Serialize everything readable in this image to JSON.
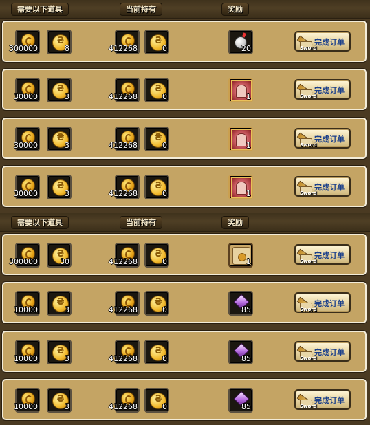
{
  "headers": {
    "required": "需要以下道具",
    "current": "当前持有",
    "reward": "奖励"
  },
  "button": {
    "label": "完成订单",
    "sublabel": "Sword"
  },
  "sections": [
    {
      "rows": [
        {
          "req_coin": "300000",
          "req_token": "8",
          "have_coin": "412268",
          "have_token": "0",
          "reward_icon": "bomb-icon",
          "reward_qty": "20"
        },
        {
          "req_coin": "30000",
          "req_token": "3",
          "have_coin": "412268",
          "have_token": "0",
          "reward_icon": "relic-icon",
          "reward_qty": "1"
        },
        {
          "req_coin": "30000",
          "req_token": "3",
          "have_coin": "412268",
          "have_token": "0",
          "reward_icon": "relic-icon",
          "reward_qty": "1"
        },
        {
          "req_coin": "30000",
          "req_token": "3",
          "have_coin": "412268",
          "have_token": "0",
          "reward_icon": "relic-icon",
          "reward_qty": "1"
        }
      ]
    },
    {
      "rows": [
        {
          "req_coin": "300000",
          "req_token": "30",
          "have_coin": "412268",
          "have_token": "0",
          "reward_icon": "scroll-icon",
          "reward_qty": "1"
        },
        {
          "req_coin": "10000",
          "req_token": "3",
          "have_coin": "412268",
          "have_token": "0",
          "reward_icon": "gem-icon",
          "reward_qty": "85"
        },
        {
          "req_coin": "10000",
          "req_token": "3",
          "have_coin": "412268",
          "have_token": "0",
          "reward_icon": "gem-icon",
          "reward_qty": "85"
        },
        {
          "req_coin": "10000",
          "req_token": "3",
          "have_coin": "412268",
          "have_token": "0",
          "reward_icon": "gem-icon",
          "reward_qty": "85"
        }
      ]
    }
  ]
}
